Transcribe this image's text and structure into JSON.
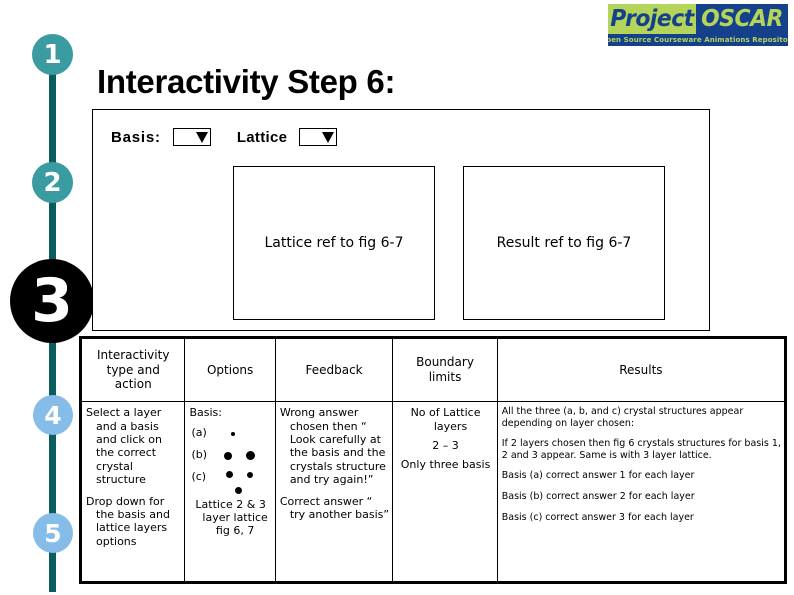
{
  "logo": {
    "word_left": "Project",
    "word_right": "OSCAR",
    "tagline": "Open Source Courseware Animations Repository",
    "color_left_bg": "#b5d45a",
    "color_right_bg": "#15418c"
  },
  "timeline": {
    "steps": [
      {
        "number": "1",
        "color": "#3a9ba0"
      },
      {
        "number": "2",
        "color": "#3a9ba0"
      },
      {
        "number": "3",
        "color": "#000000"
      },
      {
        "number": "4",
        "color": "#85bce8"
      },
      {
        "number": "5",
        "color": "#85bce8"
      }
    ],
    "line_color": "#0b5c5e"
  },
  "title": "Interactivity Step 6:",
  "panel": {
    "basis_label": "Basis:",
    "lattice_label": "Lattice",
    "basis_dropdown_value": "",
    "lattice_dropdown_value": "",
    "lattice_ref_text": "Lattice ref to fig 6-7",
    "result_ref_text": "Result ref to fig 6-7"
  },
  "table": {
    "headers": [
      "Interactivity type and action",
      "Options",
      "Feedback",
      "Boundary limits",
      "Results"
    ],
    "header_parts": {
      "col1_line1": "Interactivity",
      "col1_line2": "type and",
      "col1_line3": "action",
      "col2": "Options",
      "col3": "Feedback",
      "col4_line1": "Boundary",
      "col4_line2": "limits",
      "col5": "Results"
    },
    "row": {
      "interactivity": [
        "Select a layer and a basis and click on the correct crystal structure",
        "Drop down for the basis and lattice layers options"
      ],
      "options": {
        "title": "Basis:",
        "letters": [
          "(a)",
          "(b)",
          "(c)"
        ],
        "tail": "Lattice 2 & 3 layer lattice fig 6, 7"
      },
      "feedback": [
        "Wrong answer chosen then “ Look carefully at the basis and the crystals structure and try again!”",
        "Correct answer “ try another basis”"
      ],
      "boundary": [
        "No of Lattice layers",
        "2 – 3",
        "Only three basis"
      ],
      "results": [
        "All the three (a, b, and c) crystal structures appear depending on layer chosen:",
        "If 2 layers chosen then fig 6 crystals structures for basis 1, 2 and 3 appear. Same is with 3 layer lattice.",
        "Basis (a) correct answer 1 for each layer",
        "Basis (b) correct answer 2 for each layer",
        "Basis (c) correct answer 3 for each layer"
      ]
    }
  }
}
